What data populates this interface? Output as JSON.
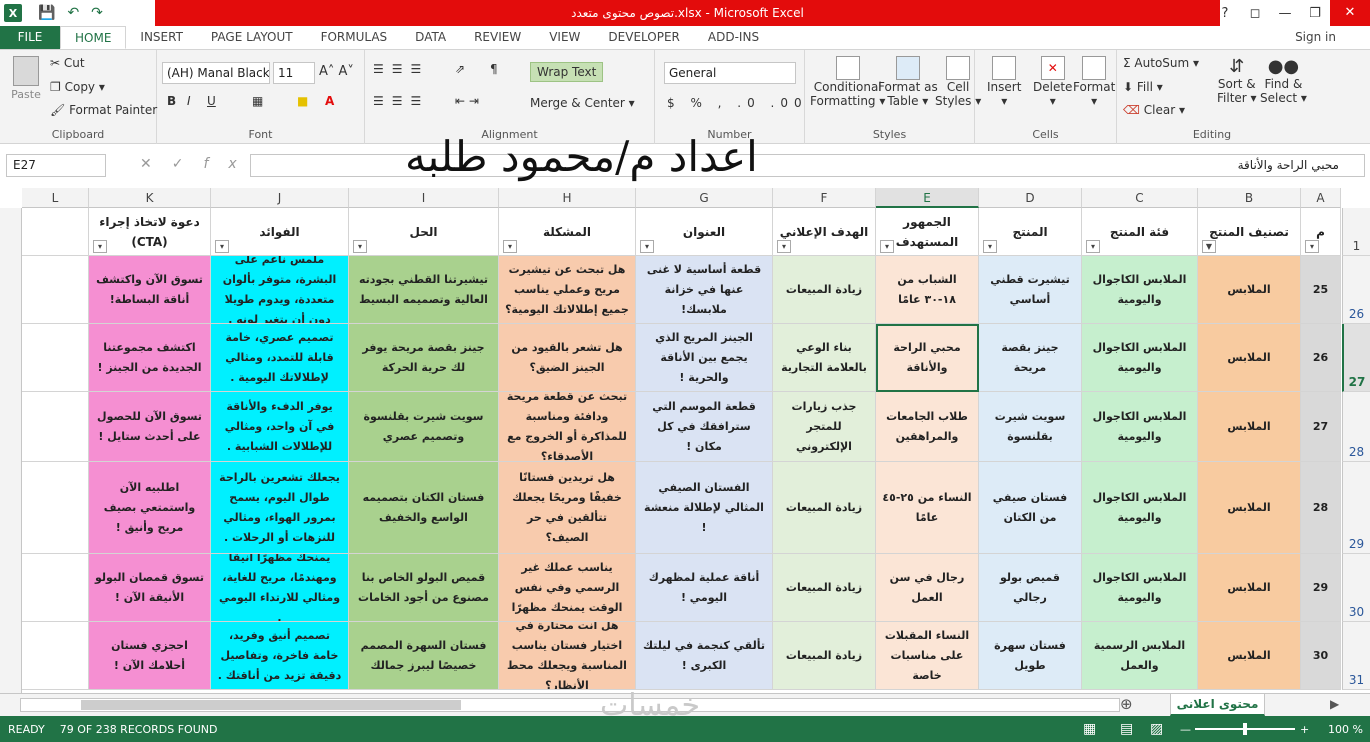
{
  "app": {
    "title": "تصوص محتوى متعدد.xlsx - Microsoft Excel",
    "logo": "X"
  },
  "tabs": [
    "FILE",
    "HOME",
    "INSERT",
    "PAGE LAYOUT",
    "FORMULAS",
    "DATA",
    "REVIEW",
    "VIEW",
    "DEVELOPER",
    "ADD-INS"
  ],
  "signin": "Sign in",
  "ribbon": {
    "paste": "Paste",
    "cut": "Cut",
    "copy": "Copy",
    "format_painter": "Format Painter",
    "clipboard": "Clipboard",
    "font_name": "(AH) Manal Black",
    "font_size": "11",
    "font": "Font",
    "wrap_text": "Wrap Text",
    "merge_center": "Merge & Center",
    "alignment": "Alignment",
    "number_format": "General",
    "number": "Number",
    "cond_fmt_1": "Conditional",
    "cond_fmt_2": "Formatting",
    "fmt_table_1": "Format as",
    "fmt_table_2": "Table",
    "cell_styles_1": "Cell",
    "cell_styles_2": "Styles",
    "styles": "Styles",
    "insert": "Insert",
    "delete": "Delete",
    "format": "Format",
    "cells": "Cells",
    "autosum": "AutoSum",
    "fill": "Fill",
    "clear": "Clear",
    "sort_1": "Sort &",
    "sort_2": "Filter",
    "find_1": "Find &",
    "find_2": "Select",
    "editing": "Editing"
  },
  "formula_bar": {
    "name_box": "E27",
    "fx": "fx",
    "content": "محبي الراحة والأناقة"
  },
  "overlay_text": "اعداد م/محمود طلبه",
  "watermark": "خمسات",
  "columns": [
    "L",
    "K",
    "J",
    "I",
    "H",
    "G",
    "F",
    "E",
    "D",
    "C",
    "B",
    "A"
  ],
  "header_row": {
    "row": "1",
    "cells": [
      "",
      "دعوة لاتخاذ إجراء (CTA)",
      "الفوائد",
      "الحل",
      "المشكلة",
      "العنوان",
      "الهدف الإعلاني",
      "الجمهور المستهدف",
      "المنتج",
      "فئة المنتج",
      "تصنيف المنتج",
      "م"
    ]
  },
  "rows": [
    {
      "rownum": "26",
      "cells": [
        "",
        "تسوق الآن واكتشف أناقة البساطة!",
        "ملمس ناعم على البشرة، متوفر بألوان متعددة، ويدوم طويلا دون أن يتغير لونه .",
        "تيشيرتنا القطني بجودته العالية وتصميمه البسيط",
        "هل تبحث عن تيشيرت مريح وعملي يناسب جميع إطلالاتك اليومية؟",
        "قطعة أساسية لا غنى عنها في خزانة ملابسك!",
        "زيادة المبيعات",
        "الشباب من ١٨-٣٠ عامًا",
        "تيشيرت قطني أساسي",
        "الملابس الكاجوال واليومية",
        "الملابس",
        "25"
      ]
    },
    {
      "rownum": "27",
      "cells": [
        "",
        "اكتشف مجموعتنا الجديدة من الجينز !",
        "تصميم عصري، خامة قابلة للتمدد، ومثالي لإطلالاتك اليومية .",
        "جينز بقصة مريحة يوفر لك حرية الحركة",
        "هل تشعر بالقيود من الجينز الضيق؟",
        "الجينز المريح الذي يجمع بين الأناقة والحرية !",
        "بناء الوعي بالعلامة التجارية",
        "محبي الراحة والأناقة",
        "جينز بقصة مريحة",
        "الملابس الكاجوال واليومية",
        "الملابس",
        "26"
      ]
    },
    {
      "rownum": "28",
      "cells": [
        "",
        "تسوق الآن للحصول على أحدث ستايل !",
        "يوفر الدفء والأناقة في آن واحد، ومثالي للإطلالات الشبابية .",
        "سويت شيرت بقلنسوة وتصميم عصري",
        "تبحث عن قطعة مريحة ودافئة ومناسبة للمذاكرة أو الخروج مع الأصدقاء؟",
        "قطعة الموسم التي سترافقك في كل مكان !",
        "جذب زيارات للمتجر الإلكتروني",
        "طلاب الجامعات والمراهقين",
        "سويت شيرت بقلنسوة",
        "الملابس الكاجوال واليومية",
        "الملابس",
        "27"
      ]
    },
    {
      "rownum": "29",
      "cells": [
        "",
        "اطلبيه الآن واستمتعي بصيف مريح وأنيق !",
        "يجعلك تشعرين بالراحة طوال اليوم، يسمح بمرور الهواء، ومثالي للنزهات أو الرحلات .",
        "فستان الكتان بتصميمه الواسع والخفيف",
        "هل تريدين فستانًا خفيفًا ومريحًا يجعلك تتألقين في حر الصيف؟",
        "الفستان الصيفي المثالي لإطلالة منعشة !",
        "زيادة المبيعات",
        "النساء من ٢٥-٤٥ عامًا",
        "فستان صيفي من الكتان",
        "الملابس الكاجوال واليومية",
        "الملابس",
        "28"
      ]
    },
    {
      "rownum": "30",
      "cells": [
        "",
        "تسوق قمصان البولو الأنيقة الآن !",
        "يمنحك مظهرًا أنيقًا ومهندمًا، مريح للغاية، ومثالي للارتداء اليومي .",
        "قميص البولو الخاص بنا مصنوع من أجود الخامات",
        "هل تبحث عن قميص يناسب عملك غير الرسمي وفي نفس الوقت يمنحك مظهرًا جذابًا؟",
        "أناقة عملية لمظهرك اليومي !",
        "زيادة المبيعات",
        "رجال في سن العمل",
        "قميص بولو رجالي",
        "الملابس الكاجوال واليومية",
        "الملابس",
        "29"
      ]
    },
    {
      "rownum": "31",
      "cells": [
        "",
        "احجزي فستان أحلامك الآن !",
        "تصميم أنيق وفريد، خامة فاخرة، وتفاصيل دقيقة تزيد من أناقتك .",
        "فستان السهرة المصمم خصيصًا ليبرز جمالك",
        "هل أنت محتارة في اختيار فستان يناسب المناسبة ويجعلك محط الأنظار؟",
        "تألقي كنجمة في ليلتك الكبرى !",
        "زيادة المبيعات",
        "النساء المقبلات على مناسبات خاصة",
        "فستان سهرة طويل",
        "الملابس الرسمية والعمل",
        "الملابس",
        "30"
      ]
    }
  ],
  "sheet_tab": "محتوى اعلانى",
  "status": {
    "ready": "READY",
    "records": "79 OF 238 RECORDS FOUND",
    "zoom": "100 %"
  },
  "colors": {
    "excel_green": "#217346",
    "title_red": "#e30c0c",
    "col_K": "#f58fd2",
    "col_J": "#00f0ff",
    "col_I": "#a9d18e",
    "col_H": "#f8cbad",
    "col_G": "#dae3f3",
    "col_F": "#e2efda",
    "col_E": "#fbe5d6",
    "col_D": "#ddebf7",
    "col_C": "#c6efce",
    "col_B": "#f8cba0",
    "col_A": "#d9d9d9"
  }
}
